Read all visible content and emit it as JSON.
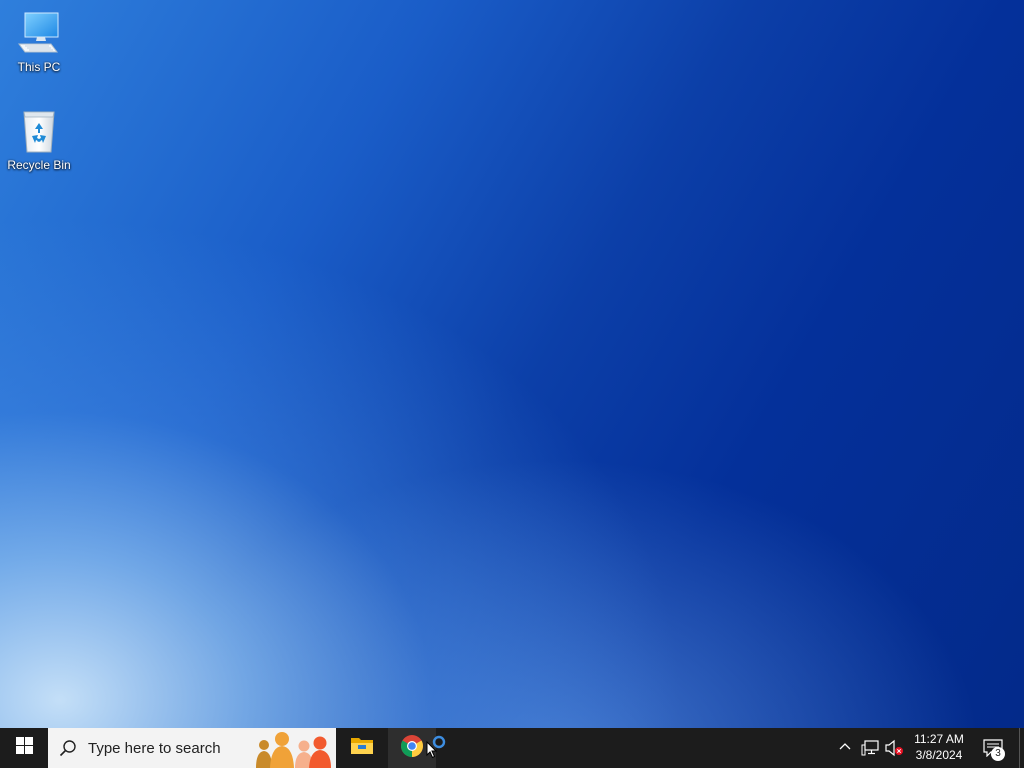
{
  "desktop": {
    "icons": [
      {
        "label": "This PC",
        "icon": "computer-icon"
      },
      {
        "label": "Recycle Bin",
        "icon": "recycle-bin-icon"
      }
    ]
  },
  "taskbar": {
    "start_icon": "windows-logo-icon",
    "search": {
      "placeholder": "Type here to search",
      "icon": "search-icon"
    },
    "apps": [
      {
        "name": "File Explorer",
        "icon": "folder-icon"
      },
      {
        "name": "Google Chrome",
        "icon": "chrome-icon"
      }
    ],
    "tray": {
      "time": "11:27 AM",
      "date": "3/8/2024",
      "notification_count": "3"
    }
  },
  "colors": {
    "taskbar_bg": "#1c1c1c",
    "search_bg": "#f3f3f3",
    "accent": "#0a6cd6"
  }
}
